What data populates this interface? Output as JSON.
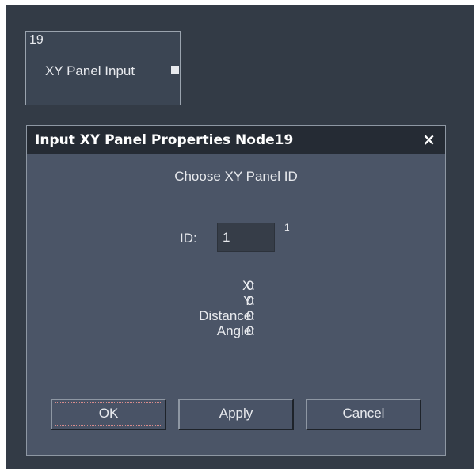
{
  "node": {
    "number": "19",
    "label": "XY Panel Input"
  },
  "dialog": {
    "title": "Input XY Panel Properties Node19",
    "close": "×",
    "heading": "Choose XY Panel ID",
    "id_label": "ID:",
    "id_value": "1",
    "id_superscript": "1",
    "readouts": [
      {
        "label": "X:",
        "value": "0"
      },
      {
        "label": "Y:",
        "value": "0"
      },
      {
        "label": "Distance:",
        "value": "0"
      },
      {
        "label": "Angle:",
        "value": "0"
      }
    ],
    "buttons": {
      "ok": "OK",
      "apply": "Apply",
      "cancel": "Cancel"
    }
  },
  "colors": {
    "canvas": "#333b46",
    "dialog_body": "#4b5567",
    "titlebar": "#252b34",
    "text": "#e8eaee"
  }
}
